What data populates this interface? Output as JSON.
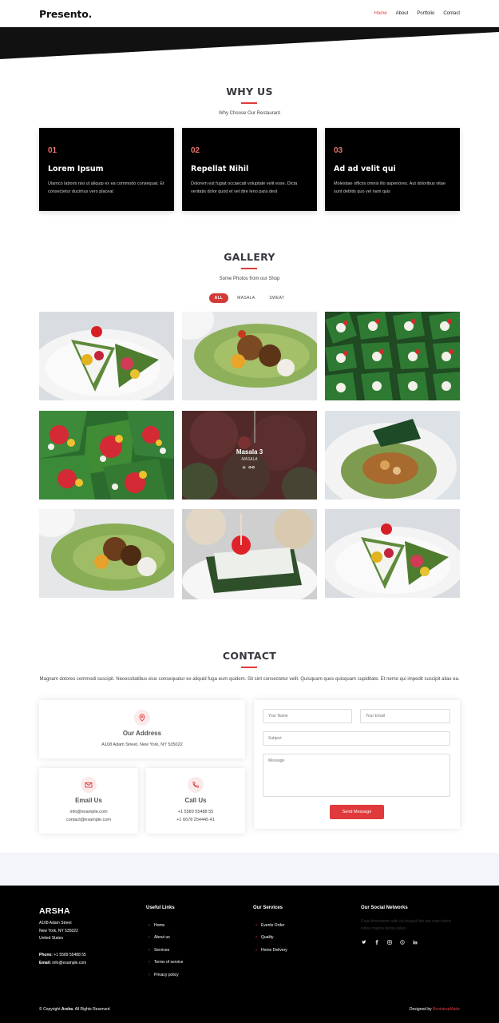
{
  "header": {
    "logo": "Presento.",
    "nav": [
      "Home",
      "About",
      "Portfolio",
      "Contact"
    ]
  },
  "why": {
    "title": "WHY US",
    "subtitle": "Why Choose Our Restaurant",
    "cards": [
      {
        "num": "01",
        "title": "Lorem Ipsum",
        "text": "Ulamco laboris nisi ut aliquip ex ea commodo consequat. Et consectetur ducimus vero placeat"
      },
      {
        "num": "02",
        "title": "Repellat Nihil",
        "text": "Dolorem est fugiat occaecati voluptate velit esse. Dicta veritatis dolor quod et vel dire leno para dest"
      },
      {
        "num": "03",
        "title": "Ad ad velit qui",
        "text": "Molestiae officiis omnis illo asperiores. Aut doloribus vitae sunt debitis quo vel nam quis"
      }
    ]
  },
  "gallery": {
    "title": "GALLERY",
    "subtitle": "Some Photos from our Shop",
    "filters": [
      "ALL",
      "MASALA",
      "SWEAT"
    ],
    "hover": {
      "title": "Masala 3",
      "category": "MASALA",
      "icons": "+ 🔗"
    }
  },
  "contact": {
    "title": "CONTACT",
    "description": "Magnam dolores commodi suscipit. Necessitatibus eius consequatur ex aliquid fuga eum quidem. Sit sint consectetur velit. Quisquam quos quisquam cupiditate. Et nemo qui impedit suscipit alias ea.",
    "address": {
      "title": "Our Address",
      "text": "A108 Adam Street, New York, NY 535022"
    },
    "email": {
      "title": "Email Us",
      "lines": [
        "info@example.com",
        "contact@example.com"
      ]
    },
    "call": {
      "title": "Call Us",
      "lines": [
        "+1 5589 55488 55",
        "+1 6678 254445 41"
      ]
    },
    "form": {
      "name_placeholder": "Your Name",
      "email_placeholder": "Your Email",
      "subject_placeholder": "Subject",
      "message_placeholder": "Message",
      "send_label": "Send Message"
    }
  },
  "footer": {
    "brand": "ARSHA",
    "address": [
      "A108 Adam Street",
      "New York, NY 535022",
      "United States"
    ],
    "phone_label": "Phone:",
    "phone": "+1 5589 55488 55",
    "email_label": "Email:",
    "email": "info@example.com",
    "useful_links": {
      "title": "Useful Links",
      "items": [
        "Home",
        "About us",
        "Services",
        "Terms of service",
        "Privacy policy"
      ]
    },
    "services": {
      "title": "Our Services",
      "items": [
        "Events Order",
        "Quality",
        "Home Delivery"
      ]
    },
    "social": {
      "title": "Our Social Networks",
      "text": "Cras fermentum odio eu feugiat lide par naso tierra videa magna derita valies",
      "icons": [
        "twitter-icon",
        "facebook-icon",
        "instagram-icon",
        "skype-icon",
        "linkedin-icon"
      ]
    },
    "copyright_prefix": "© Copyright",
    "copyright_brand": "Arsha",
    "copyright_suffix": ". All Rights Reserved",
    "designed_prefix": "Designed by",
    "designed_by": "BootstrapMade"
  },
  "colors": {
    "accent": "#e03a3c",
    "dark": "#000000",
    "band": "#f3f5fa"
  }
}
